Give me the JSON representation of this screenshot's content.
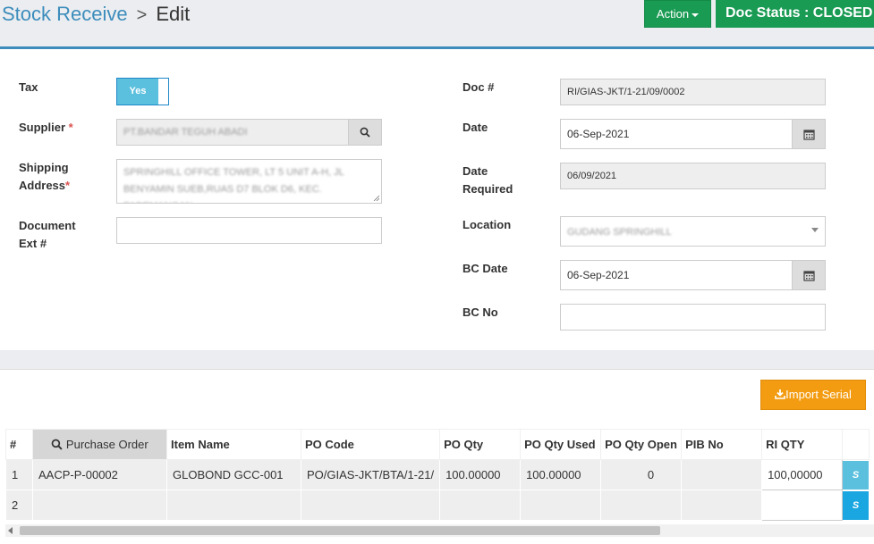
{
  "header": {
    "breadcrumb_link": "Stock Receive",
    "breadcrumb_sep": ">",
    "breadcrumb_current": "Edit",
    "action_label": "Action",
    "doc_status": "Doc Status : CLOSED"
  },
  "form": {
    "tax_label": "Tax",
    "tax_toggle": "Yes",
    "supplier_label": "Supplier",
    "required_mark": "*",
    "supplier_value": "PT.BANDAR TEGUH ABADI",
    "shipping_label_1": "Shipping",
    "shipping_label_2": "Address",
    "shipping_value": "SPRINGHILL OFFICE TOWER, LT 5 UNIT A-H, JL BENYAMIN SUEB,RUAS D7 BLOK D6, KEC. PADEMANGAN",
    "docext_label_1": "Document",
    "docext_label_2": "Ext #",
    "docext_value": "",
    "docno_label": "Doc #",
    "docno_value": "RI/GIAS-JKT/1-21/09/0002",
    "date_label": "Date",
    "date_value": "06-Sep-2021",
    "daterequired_label_1": "Date",
    "daterequired_label_2": "Required",
    "daterequired_value": "06/09/2021",
    "location_label": "Location",
    "location_value": "GUDANG SPRINGHILL",
    "bcdate_label": "BC Date",
    "bcdate_value": "06-Sep-2021",
    "bcno_label": "BC No",
    "bcno_value": ""
  },
  "import_serial_label": "Import Serial",
  "table": {
    "headers": [
      "#",
      "Purchase Order",
      "Item Name",
      "PO Code",
      "PO Qty",
      "PO Qty Used",
      "PO Qty Open",
      "PIB No",
      "RI QTY"
    ],
    "rows": [
      {
        "no": "1",
        "po": "AACP-P-00002",
        "item": "GLOBOND GCC-001",
        "pocode": "PO/GIAS-JKT/BTA/1-21/",
        "poqty": "100.00000",
        "poqtyused": "100.00000",
        "poqtyopen": "0",
        "pib": "",
        "riqty": "100,00000",
        "s": "S"
      },
      {
        "no": "2",
        "po": "",
        "item": "",
        "pocode": "",
        "poqty": "",
        "poqtyused": "",
        "poqtyopen": "",
        "pib": "",
        "riqty": "",
        "s": "S"
      }
    ]
  },
  "colors": {
    "accent": "#3c8dbc",
    "status_green": "#1a9b54",
    "import_orange": "#f39c12",
    "toggle_blue": "#5bc0de"
  },
  "icons": {
    "supplier_lookup": "search-icon",
    "date_picker": "calendar-icon",
    "import": "download-icon",
    "purchase_order_lookup": "search-icon"
  }
}
